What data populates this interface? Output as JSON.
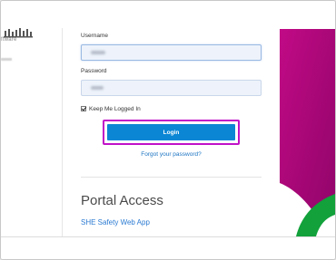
{
  "brand": {
    "subtitle": "ftware"
  },
  "login_form": {
    "username_label": "Username",
    "password_label": "Password",
    "remember_label": "Keep Me Logged In",
    "remember_checked": true,
    "login_button": "Login",
    "forgot_link": "Forgot your password?"
  },
  "portal": {
    "title": "Portal Access",
    "links": [
      "SHE Safety Web App"
    ]
  },
  "colors": {
    "login_button": "#0a86d5",
    "highlight_outline": "#c011c8",
    "link": "#1a73c2",
    "art_magenta": "#b0067c",
    "art_green": "#12a13b"
  }
}
